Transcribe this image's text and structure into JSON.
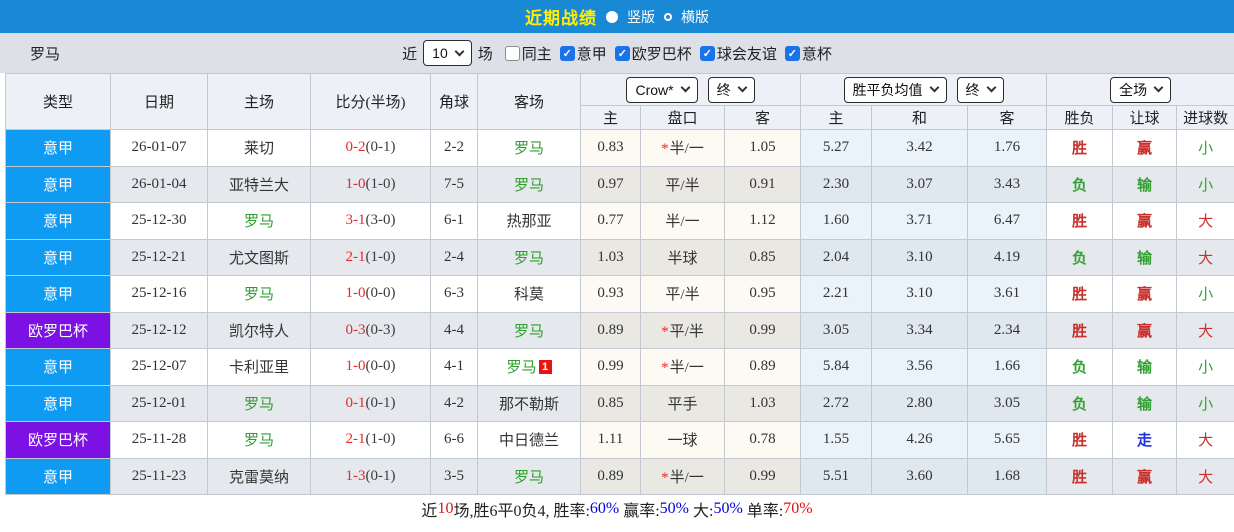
{
  "colors": {
    "topbar_blue": "#1989d5",
    "title_yellow": "#ffee00",
    "serie_a_blue": "#0f9bf2",
    "europa_purple": "#7b11e3",
    "focus_team_green": "#2f9e2f",
    "score_red": "#e42b2b",
    "win_red": "#c9302c",
    "lose_green": "#35a035",
    "push_blue": "#1f2ee0"
  },
  "titlebar": {
    "title": "近期战绩",
    "radio_options": [
      {
        "label": "竖版",
        "selected": true
      },
      {
        "label": "横版",
        "selected": false
      }
    ]
  },
  "filters": {
    "team": "罗马",
    "near_label": "近",
    "match_count": "10",
    "matches_label": "场",
    "checkboxes": [
      {
        "label": "同主",
        "checked": false
      },
      {
        "label": "意甲",
        "checked": true
      },
      {
        "label": "欧罗巴杯",
        "checked": true
      },
      {
        "label": "球会友谊",
        "checked": true
      },
      {
        "label": "意杯",
        "checked": true
      }
    ]
  },
  "table": {
    "static_headers": [
      "类型",
      "日期",
      "主场",
      "比分(半场)",
      "角球",
      "客场"
    ],
    "selects": {
      "odds_source": "Crow*",
      "odds_time": "终",
      "avg_label": "胜平负均值",
      "avg_time": "终",
      "scope": "全场"
    },
    "sub_headers": [
      "主",
      "盘口",
      "客",
      "主",
      "和",
      "客",
      "胜负",
      "让球",
      "进球数"
    ],
    "rows": [
      {
        "type": "意甲",
        "type_color": "blue",
        "date": "26-01-07",
        "home": "莱切",
        "home_is_focus": false,
        "score": "0-2",
        "half": "(0-1)",
        "corner": "2-2",
        "away": "罗马",
        "away_is_focus": true,
        "red_card": null,
        "odds_home": "0.83",
        "handicap_star": true,
        "handicap": "半/一",
        "odds_away": "1.05",
        "avg_home": "5.27",
        "avg_draw": "3.42",
        "avg_away": "1.76",
        "outcome": {
          "text": "胜",
          "color": "red"
        },
        "handicap_result": {
          "text": "赢",
          "color": "red"
        },
        "goals_result": {
          "text": "小",
          "color": "green"
        }
      },
      {
        "type": "意甲",
        "type_color": "blue",
        "date": "26-01-04",
        "home": "亚特兰大",
        "home_is_focus": false,
        "score": "1-0",
        "half": "(1-0)",
        "corner": "7-5",
        "away": "罗马",
        "away_is_focus": true,
        "red_card": null,
        "odds_home": "0.97",
        "handicap_star": false,
        "handicap": "平/半",
        "odds_away": "0.91",
        "avg_home": "2.30",
        "avg_draw": "3.07",
        "avg_away": "3.43",
        "outcome": {
          "text": "负",
          "color": "green"
        },
        "handicap_result": {
          "text": "输",
          "color": "green"
        },
        "goals_result": {
          "text": "小",
          "color": "green"
        }
      },
      {
        "type": "意甲",
        "type_color": "blue",
        "date": "25-12-30",
        "home": "罗马",
        "home_is_focus": true,
        "score": "3-1",
        "half": "(3-0)",
        "corner": "6-1",
        "away": "热那亚",
        "away_is_focus": false,
        "red_card": null,
        "odds_home": "0.77",
        "handicap_star": false,
        "handicap": "半/一",
        "odds_away": "1.12",
        "avg_home": "1.60",
        "avg_draw": "3.71",
        "avg_away": "6.47",
        "outcome": {
          "text": "胜",
          "color": "red"
        },
        "handicap_result": {
          "text": "赢",
          "color": "red"
        },
        "goals_result": {
          "text": "大",
          "color": "red"
        }
      },
      {
        "type": "意甲",
        "type_color": "blue",
        "date": "25-12-21",
        "home": "尤文图斯",
        "home_is_focus": false,
        "score": "2-1",
        "half": "(1-0)",
        "corner": "2-4",
        "away": "罗马",
        "away_is_focus": true,
        "red_card": null,
        "odds_home": "1.03",
        "handicap_star": false,
        "handicap": "半球",
        "odds_away": "0.85",
        "avg_home": "2.04",
        "avg_draw": "3.10",
        "avg_away": "4.19",
        "outcome": {
          "text": "负",
          "color": "green"
        },
        "handicap_result": {
          "text": "输",
          "color": "green"
        },
        "goals_result": {
          "text": "大",
          "color": "red"
        }
      },
      {
        "type": "意甲",
        "type_color": "blue",
        "date": "25-12-16",
        "home": "罗马",
        "home_is_focus": true,
        "score": "1-0",
        "half": "(0-0)",
        "corner": "6-3",
        "away": "科莫",
        "away_is_focus": false,
        "red_card": null,
        "odds_home": "0.93",
        "handicap_star": false,
        "handicap": "平/半",
        "odds_away": "0.95",
        "avg_home": "2.21",
        "avg_draw": "3.10",
        "avg_away": "3.61",
        "outcome": {
          "text": "胜",
          "color": "red"
        },
        "handicap_result": {
          "text": "赢",
          "color": "red"
        },
        "goals_result": {
          "text": "小",
          "color": "green"
        }
      },
      {
        "type": "欧罗巴杯",
        "type_color": "purple",
        "date": "25-12-12",
        "home": "凯尔特人",
        "home_is_focus": false,
        "score": "0-3",
        "half": "(0-3)",
        "corner": "4-4",
        "away": "罗马",
        "away_is_focus": true,
        "red_card": null,
        "odds_home": "0.89",
        "handicap_star": true,
        "handicap": "平/半",
        "odds_away": "0.99",
        "avg_home": "3.05",
        "avg_draw": "3.34",
        "avg_away": "2.34",
        "outcome": {
          "text": "胜",
          "color": "red"
        },
        "handicap_result": {
          "text": "赢",
          "color": "red"
        },
        "goals_result": {
          "text": "大",
          "color": "red"
        }
      },
      {
        "type": "意甲",
        "type_color": "blue",
        "date": "25-12-07",
        "home": "卡利亚里",
        "home_is_focus": false,
        "score": "1-0",
        "half": "(0-0)",
        "corner": "4-1",
        "away": "罗马",
        "away_is_focus": true,
        "red_card": "1",
        "odds_home": "0.99",
        "handicap_star": true,
        "handicap": "半/一",
        "odds_away": "0.89",
        "avg_home": "5.84",
        "avg_draw": "3.56",
        "avg_away": "1.66",
        "outcome": {
          "text": "负",
          "color": "green"
        },
        "handicap_result": {
          "text": "输",
          "color": "green"
        },
        "goals_result": {
          "text": "小",
          "color": "green"
        }
      },
      {
        "type": "意甲",
        "type_color": "blue",
        "date": "25-12-01",
        "home": "罗马",
        "home_is_focus": true,
        "score": "0-1",
        "half": "(0-1)",
        "corner": "4-2",
        "away": "那不勒斯",
        "away_is_focus": false,
        "red_card": null,
        "odds_home": "0.85",
        "handicap_star": false,
        "handicap": "平手",
        "odds_away": "1.03",
        "avg_home": "2.72",
        "avg_draw": "2.80",
        "avg_away": "3.05",
        "outcome": {
          "text": "负",
          "color": "green"
        },
        "handicap_result": {
          "text": "输",
          "color": "green"
        },
        "goals_result": {
          "text": "小",
          "color": "green"
        }
      },
      {
        "type": "欧罗巴杯",
        "type_color": "purple",
        "date": "25-11-28",
        "home": "罗马",
        "home_is_focus": true,
        "score": "2-1",
        "half": "(1-0)",
        "corner": "6-6",
        "away": "中日德兰",
        "away_is_focus": false,
        "red_card": null,
        "odds_home": "1.11",
        "handicap_star": false,
        "handicap": "一球",
        "odds_away": "0.78",
        "avg_home": "1.55",
        "avg_draw": "4.26",
        "avg_away": "5.65",
        "outcome": {
          "text": "胜",
          "color": "red"
        },
        "handicap_result": {
          "text": "走",
          "color": "blue"
        },
        "goals_result": {
          "text": "大",
          "color": "red"
        }
      },
      {
        "type": "意甲",
        "type_color": "blue",
        "date": "25-11-23",
        "home": "克雷莫纳",
        "home_is_focus": false,
        "score": "1-3",
        "half": "(0-1)",
        "corner": "3-5",
        "away": "罗马",
        "away_is_focus": true,
        "red_card": null,
        "odds_home": "0.89",
        "handicap_star": true,
        "handicap": "半/一",
        "odds_away": "0.99",
        "avg_home": "5.51",
        "avg_draw": "3.60",
        "avg_away": "1.68",
        "outcome": {
          "text": "胜",
          "color": "red"
        },
        "handicap_result": {
          "text": "赢",
          "color": "red"
        },
        "goals_result": {
          "text": "大",
          "color": "red"
        }
      }
    ]
  },
  "footer": {
    "segments": [
      {
        "text": "近",
        "color": "black"
      },
      {
        "text": "10",
        "color": "red"
      },
      {
        "text": "场,胜6平0负4, 胜率:",
        "color": "black"
      },
      {
        "text": "60%",
        "color": "blue"
      },
      {
        "text": " 赢率:",
        "color": "black"
      },
      {
        "text": "50%",
        "color": "blue"
      },
      {
        "text": " 大:",
        "color": "black"
      },
      {
        "text": "50%",
        "color": "blue"
      },
      {
        "text": " 单率:",
        "color": "black"
      },
      {
        "text": "70%",
        "color": "red"
      }
    ]
  }
}
